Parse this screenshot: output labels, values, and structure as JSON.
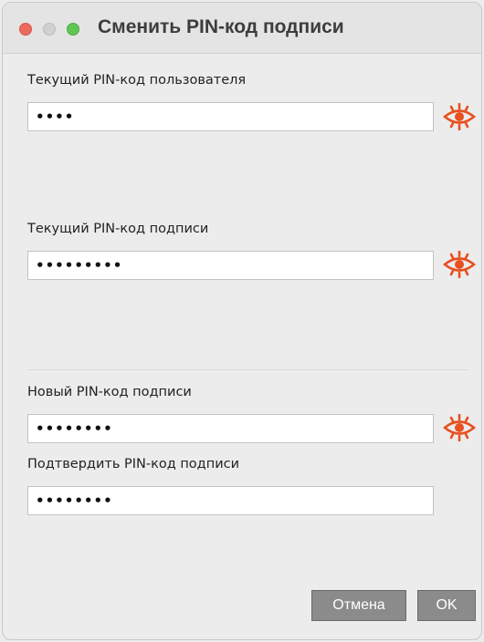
{
  "window": {
    "title": "Сменить PIN-код подписи"
  },
  "fields": {
    "current_user_pin": {
      "label": "Текущий PIN-код пользователя",
      "value": "••••"
    },
    "current_sign_pin": {
      "label": "Текущий PIN-код подписи",
      "value": "•••••••••"
    },
    "new_sign_pin": {
      "label": "Новый PIN-код подписи",
      "value": "••••••••"
    },
    "confirm_sign_pin": {
      "label": "Подтвердить PIN-код подписи",
      "value": "••••••••"
    }
  },
  "buttons": {
    "cancel_label": "Отмена",
    "ok_label": "OK"
  },
  "icons": {
    "reveal": "eye-icon"
  },
  "colors": {
    "eye_accent": "#e8501f",
    "button_bg": "#8b8b8b",
    "close": "#ed6a5e",
    "minimize": "#d0d0d0",
    "maximize": "#61c554"
  }
}
